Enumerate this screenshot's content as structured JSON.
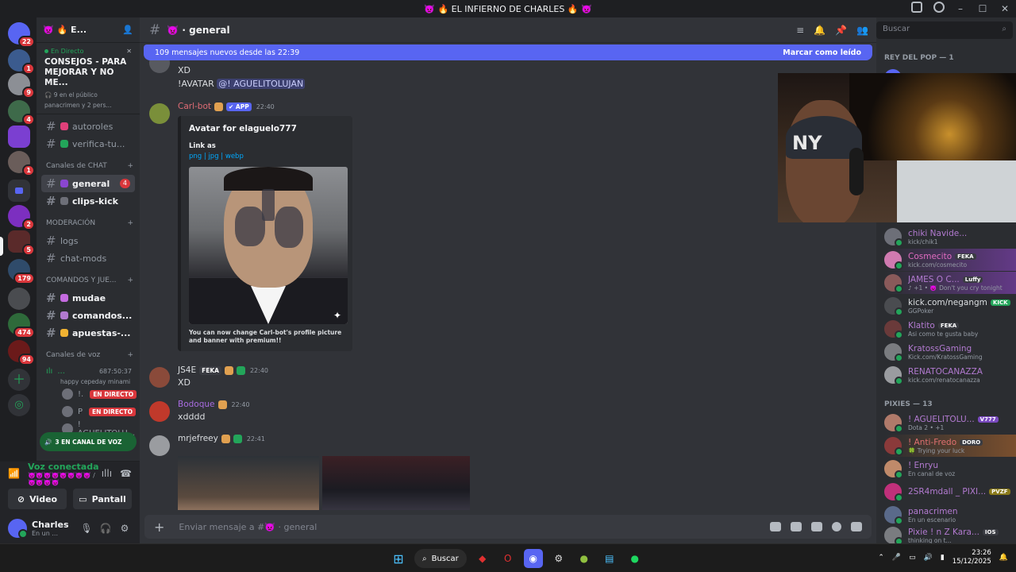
{
  "window": {
    "title": "👿 🔥 EL INFIERNO DE CHARLES 🔥 👿"
  },
  "servers": [
    {
      "badge": "22"
    },
    {
      "badge": "1"
    },
    {
      "badge": "9"
    },
    {
      "badge": "4"
    },
    {
      "badge": ""
    },
    {
      "badge": "1"
    },
    {
      "badge": ""
    },
    {
      "badge": "2"
    },
    {
      "badge": "5"
    },
    {
      "badge": "179"
    },
    {
      "badge": ""
    },
    {
      "badge": "474"
    },
    {
      "badge": "94"
    }
  ],
  "guild": {
    "name": "👿 🔥 E...",
    "stage": {
      "live_label": "En Directo",
      "title": "CONSEJOS - PARA MEJORAR Y NO ME...",
      "audience": "🎧 9 en el público",
      "speakers": "panacrimen y 2 pers..."
    }
  },
  "channels_top": [
    {
      "name": "autoroles",
      "color": "#e0407a"
    },
    {
      "name": "verifica-tu...",
      "color": "#23a55a"
    }
  ],
  "categories": {
    "chat": "Canales de CHAT",
    "moderation": "MODERACIÓN",
    "commands": "COMANDOS Y JUE...",
    "voice": "Canales de voz"
  },
  "channels_chat": [
    {
      "name": "general",
      "count": "4",
      "color": "#8a46d0"
    },
    {
      "name": "clips-kick",
      "count": "",
      "color": "#6d6f78"
    }
  ],
  "channels_mod": [
    {
      "name": "logs"
    },
    {
      "name": "chat-mods"
    }
  ],
  "channels_cmd": [
    {
      "name": "mudae",
      "color": "#c46be0"
    },
    {
      "name": "comandos...",
      "color": "#b27ad0"
    },
    {
      "name": "apuestas-...",
      "color": "#f0b232"
    }
  ],
  "voice_channel": {
    "name": "...",
    "time": "687:50:37",
    "sub": "happy cepeday minami",
    "users": [
      {
        "name": "!.",
        "live": "EN DIRECTO"
      },
      {
        "name": "P",
        "live": "EN DIRECTO"
      },
      {
        "name": "! AGUELITOLU...",
        "live": ""
      }
    ],
    "banner": "3 EN CANAL DE VOZ"
  },
  "panel": {
    "status": "Voz conectada",
    "status_sub": "👿👿👿👿👿👿👿👿 / 👿👿👿👿",
    "video": "Video",
    "screen": "Pantall",
    "user_name": "Charles",
    "user_status": "En un ..."
  },
  "chat": {
    "channel": "👿 · general",
    "new_messages": "109 mensajes nuevos desde las 22:39",
    "mark_read": "Marcar como leído",
    "composer_placeholder": "Enviar mensaje a #👿 · general",
    "messages": [
      {
        "lines": [
          "XD",
          "!AVATAR"
        ],
        "mention": "@! AGUELITOLUJAN"
      },
      {
        "user": "Carl-bot",
        "user_color": "#e06c75",
        "tag": "✔ APP",
        "time": "22:40",
        "embed_title": "Avatar for elaguelo777",
        "embed_link_label": "Link as",
        "embed_links": "png | jpg | webp",
        "embed_footer": "You can now change Carl-bot's profile picture and banner with premium!!"
      },
      {
        "user": "JS4E",
        "user_color": "#dbdee1",
        "tag": "FEKA",
        "time": "22:40",
        "text": "XD"
      },
      {
        "user": "Bodoque",
        "user_color": "#a86ce0",
        "time": "22:40",
        "text": "xdddd"
      },
      {
        "user": "mrjefreey",
        "user_color": "#dbdee1",
        "time": "22:41"
      }
    ]
  },
  "members": {
    "search_placeholder": "Buscar",
    "section1": "REY DEL POP — 1",
    "section2": "PIXIES — 13",
    "list1": [
      {
        "name": "chiki Navide...",
        "sub": "kick/chik1",
        "color": "#b27ad0",
        "tag": ""
      },
      {
        "name": "Cosmecito",
        "sub": "kick.com/cosmecito",
        "color": "#e06cc0",
        "tag": "FEKA"
      },
      {
        "name": "JAMES O C...",
        "sub": "♪ +1 • 👿 Don't you cry tonight",
        "color": "#b27ad0",
        "tag": "Luffy"
      },
      {
        "name": "kick.com/negangm",
        "sub": "GGPoker",
        "color": "#dbdee1",
        "tag": "KICK"
      },
      {
        "name": "Klatito",
        "sub": "Asi como te gusta baby",
        "color": "#b27ad0",
        "tag": "FEKA"
      },
      {
        "name": "KratossGaming",
        "sub": "Kick.com/KratossGaming",
        "color": "#b27ad0",
        "tag": ""
      },
      {
        "name": "RENATOCANAZZA",
        "sub": "kick.com/renatocanazza",
        "color": "#b27ad0",
        "tag": ""
      }
    ],
    "list2": [
      {
        "name": "! AGUELITOLU...",
        "sub": "Dota 2 • +1",
        "color": "#b27ad0",
        "tag": "V777"
      },
      {
        "name": "! Anti-Fredo",
        "sub": "🍀 Trying your luck",
        "color": "#e07070",
        "tag": "DORO"
      },
      {
        "name": "! Enryu",
        "sub": "En canal de voz",
        "color": "#b27ad0",
        "tag": ""
      },
      {
        "name": "2SR4mdall _ PIXI...",
        "sub": "",
        "color": "#b27ad0",
        "tag": "PVZF"
      },
      {
        "name": "panacrimen",
        "sub": "En un escenario",
        "color": "#b27ad0",
        "tag": ""
      },
      {
        "name": "Pixie ! n Z Kara...",
        "sub": "thinking on t...",
        "color": "#b27ad0",
        "tag": "IOS"
      }
    ]
  },
  "taskbar": {
    "search": "Buscar",
    "time": "23:26",
    "date": "15/12/2025"
  }
}
